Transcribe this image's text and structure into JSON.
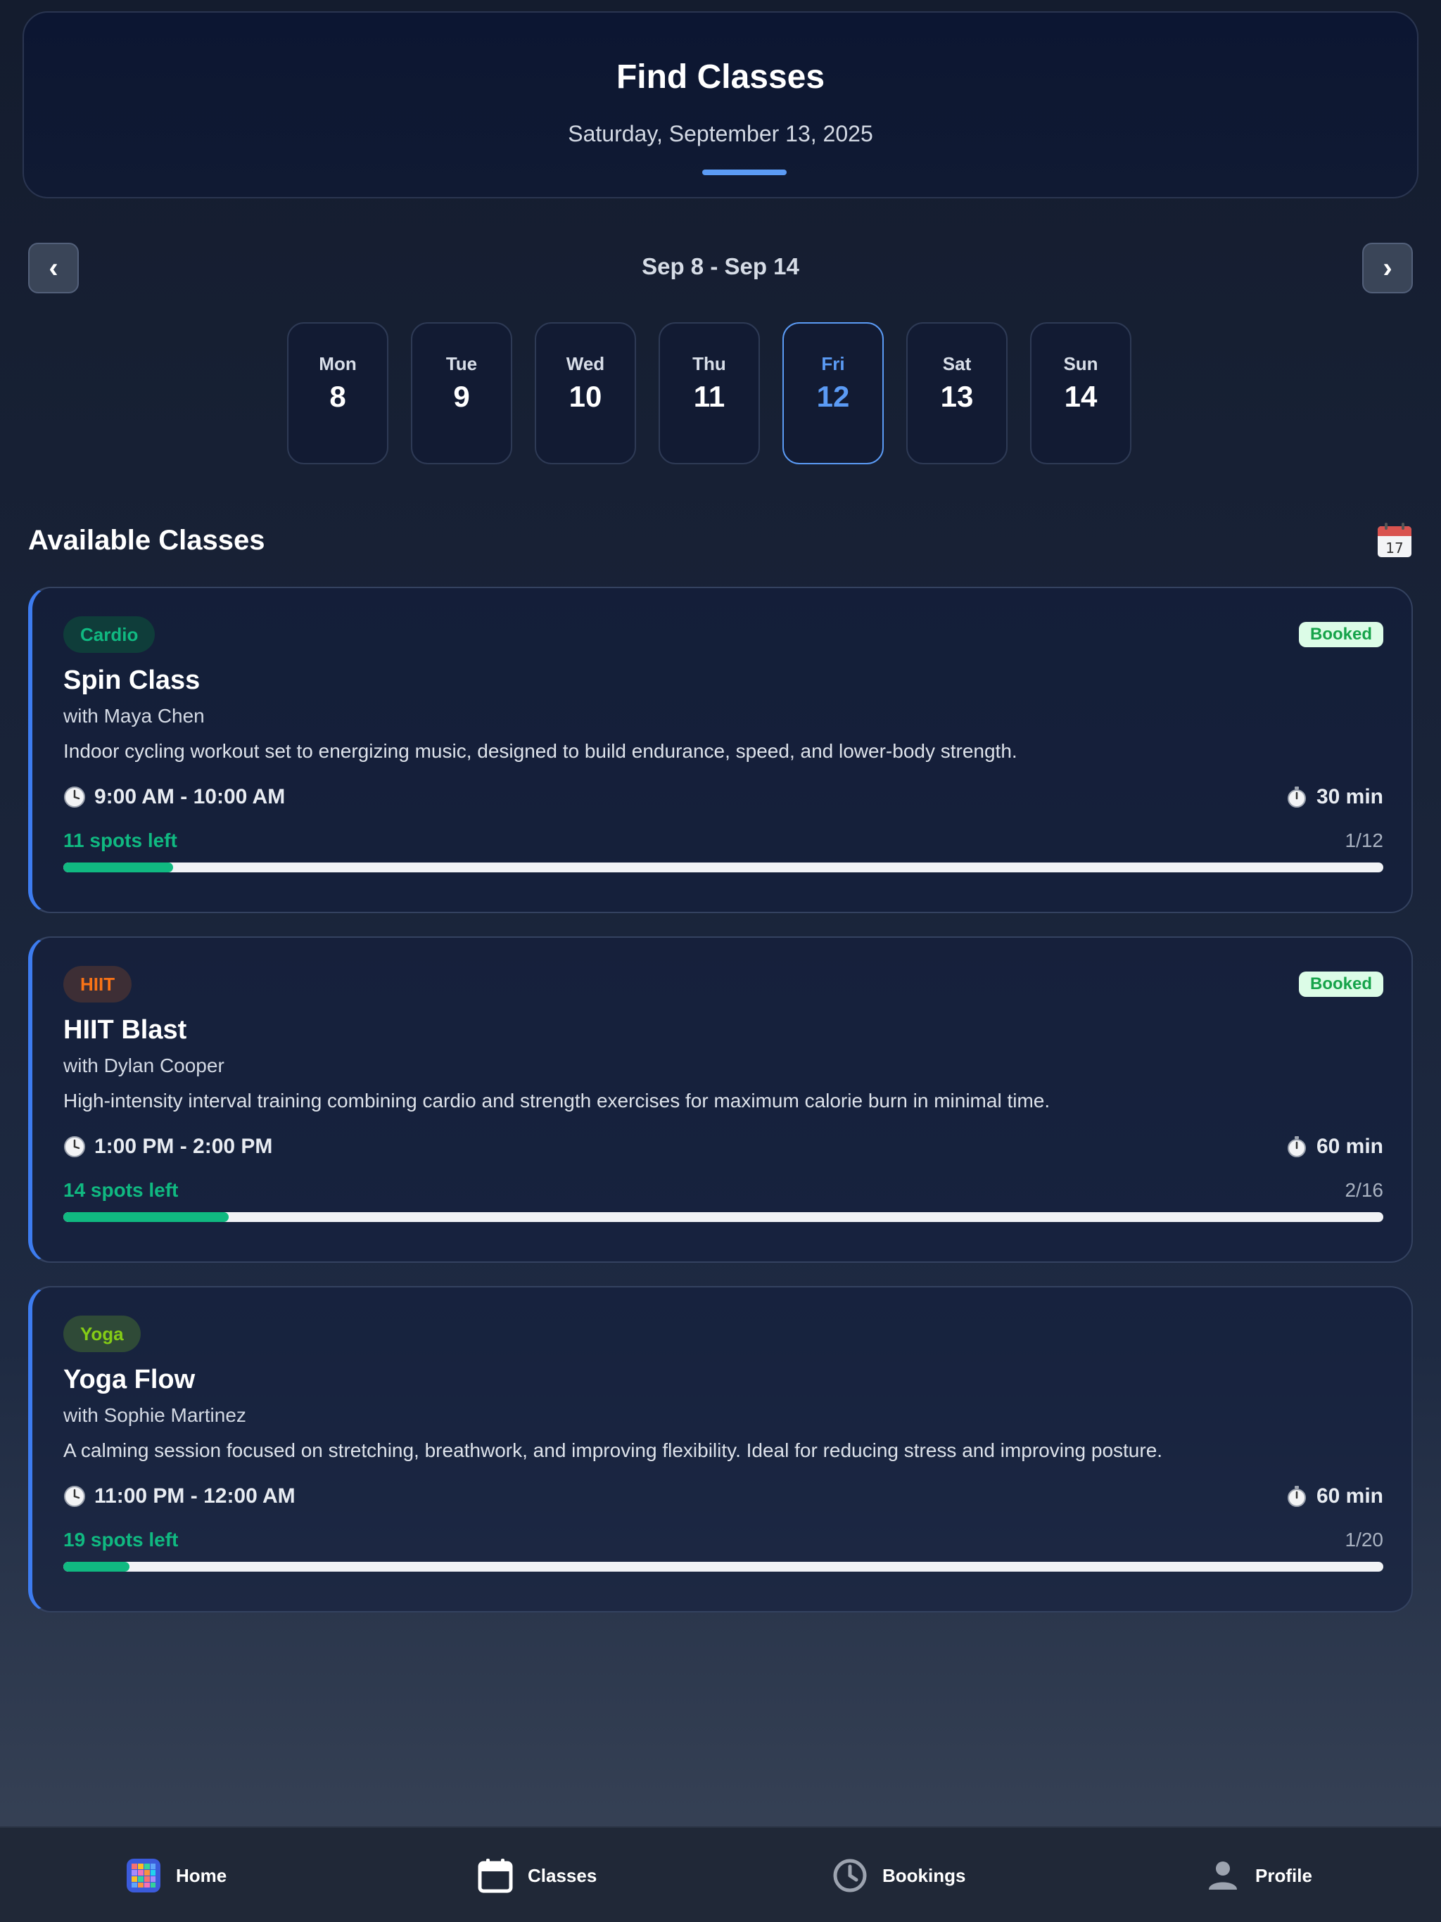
{
  "header": {
    "title": "Find Classes",
    "date": "Saturday, September 13, 2025"
  },
  "week": {
    "range": "Sep 8 - Sep 14",
    "prev_label": "‹",
    "next_label": "›",
    "days": [
      {
        "name": "Mon",
        "num": "8"
      },
      {
        "name": "Tue",
        "num": "9"
      },
      {
        "name": "Wed",
        "num": "10"
      },
      {
        "name": "Thu",
        "num": "11"
      },
      {
        "name": "Fri",
        "num": "12"
      },
      {
        "name": "Sat",
        "num": "13"
      },
      {
        "name": "Sun",
        "num": "14"
      }
    ],
    "selected_day": "Fri"
  },
  "section": {
    "title": "Available Classes",
    "icon": "calendar-icon"
  },
  "classes": [
    {
      "category": "Cardio",
      "status": "Booked",
      "name": "Spin Class",
      "instructor": "with Maya Chen",
      "description": "Indoor cycling workout set to energizing music, designed to build endurance, speed, and lower-body strength.",
      "time": "9:00 AM - 10:00 AM",
      "duration": "30 min",
      "spots": "11 spots left",
      "capacity": "1/12",
      "fill_fraction": 0.083,
      "tag_bg": "#0f3d3a",
      "tag_color": "#10b981"
    },
    {
      "category": "HIIT",
      "status": "Booked",
      "name": "HIIT Blast",
      "instructor": "with Dylan Cooper",
      "description": "High-intensity interval training combining cardio and strength exercises for maximum calorie burn in minimal time.",
      "time": "1:00 PM - 2:00 PM",
      "duration": "60 min",
      "spots": "14 spots left",
      "capacity": "2/16",
      "fill_fraction": 0.125,
      "tag_bg": "#3d2e35",
      "tag_color": "#f97316"
    },
    {
      "category": "Yoga",
      "status": "",
      "name": "Yoga Flow",
      "instructor": "with Sophie Martinez",
      "description": "A calming session focused on stretching, breathwork, and improving flexibility. Ideal for reducing stress and improving posture.",
      "time": "11:00 PM - 12:00 AM",
      "duration": "60 min",
      "spots": "19 spots left",
      "capacity": "1/20",
      "fill_fraction": 0.05,
      "tag_bg": "#2f4a37",
      "tag_color": "#84cc16"
    }
  ],
  "bottom_nav": [
    {
      "label": "Home",
      "icon": "home-icon"
    },
    {
      "label": "Classes",
      "icon": "calendar-icon"
    },
    {
      "label": "Bookings",
      "icon": "clock-icon"
    },
    {
      "label": "Profile",
      "icon": "person-icon"
    }
  ],
  "colors": {
    "accent": "#5b9bf5",
    "card_border_accent": "#3d7cf0",
    "spots_green": "#10b981",
    "booked_bg": "#dcfce7",
    "booked_text": "#16a34a"
  }
}
